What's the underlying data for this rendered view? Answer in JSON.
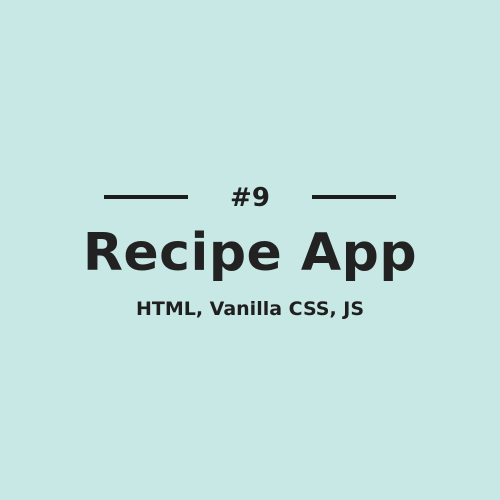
{
  "header": {
    "number": "#9",
    "title": "Recipe App",
    "subtitle": "HTML, Vanilla CSS, JS"
  },
  "colors": {
    "background": "#c8e8e6",
    "text": "#222222",
    "rule": "#1c1c1c"
  }
}
